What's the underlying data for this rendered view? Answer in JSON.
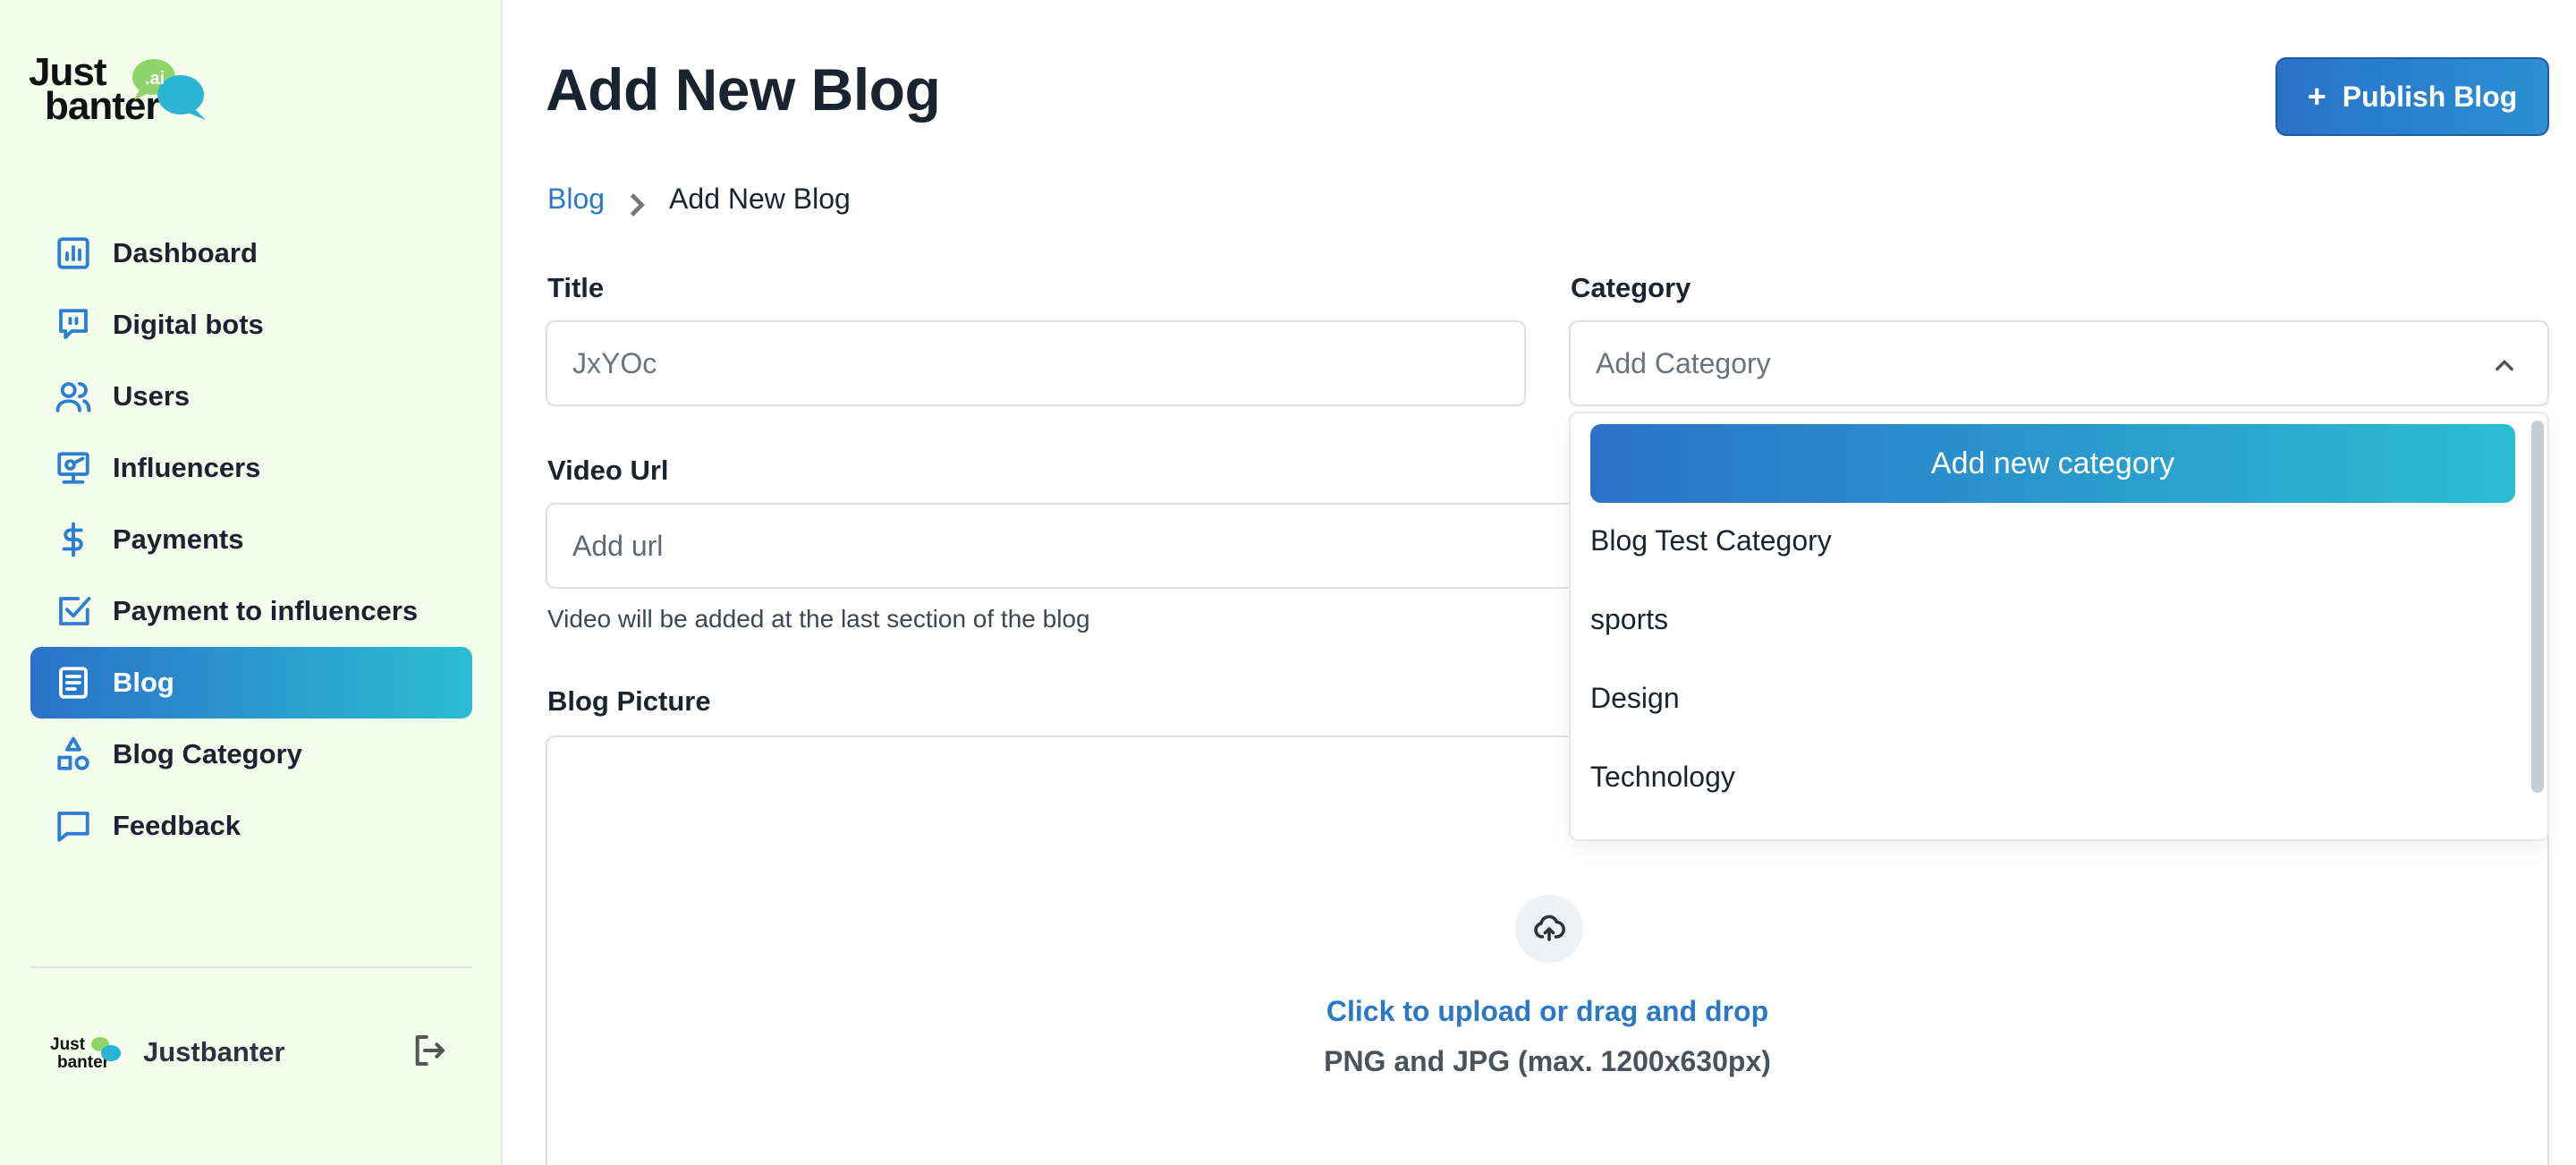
{
  "brand": {
    "logo_line1": "Just",
    "logo_line2": "banter",
    "logo_badge": ".ai"
  },
  "sidebar": {
    "items": [
      {
        "label": "Dashboard",
        "icon": "chart-icon",
        "active": false
      },
      {
        "label": "Digital bots",
        "icon": "chat-bot-icon",
        "active": false
      },
      {
        "label": "Users",
        "icon": "users-icon",
        "active": false
      },
      {
        "label": "Influencers",
        "icon": "influencer-icon",
        "active": false
      },
      {
        "label": "Payments",
        "icon": "dollar-icon",
        "active": false
      },
      {
        "label": "Payment to influencers",
        "icon": "checkbox-icon",
        "active": false
      },
      {
        "label": "Blog",
        "icon": "document-icon",
        "active": true
      },
      {
        "label": "Blog Category",
        "icon": "shapes-icon",
        "active": false
      },
      {
        "label": "Feedback",
        "icon": "message-icon",
        "active": false
      }
    ],
    "user": {
      "name": "Justbanter"
    }
  },
  "header": {
    "title": "Add New Blog",
    "publish_label": "Publish Blog",
    "publish_icon": "plus-icon"
  },
  "breadcrumb": {
    "parent": "Blog",
    "current": "Add New Blog"
  },
  "form": {
    "title": {
      "label": "Title",
      "value": "JxYOc"
    },
    "category": {
      "label": "Category",
      "placeholder": "Add Category"
    },
    "video": {
      "label": "Video Url",
      "placeholder": "Add url",
      "hint": "Video will be added at the last section of the blog"
    },
    "picture": {
      "label": "Blog Picture",
      "cta": "Click to upload or drag and drop",
      "sub": "PNG and JPG (max. 1200x630px)"
    }
  },
  "dropdown": {
    "add_label": "Add new category",
    "options": [
      "Blog Test Category",
      "sports",
      "Design",
      "Technology"
    ]
  },
  "colors": {
    "accent_start": "#2a72c8",
    "accent_end": "#2bbdd2",
    "sidebar_bg": "#f4fcec",
    "link": "#2b78c8"
  }
}
